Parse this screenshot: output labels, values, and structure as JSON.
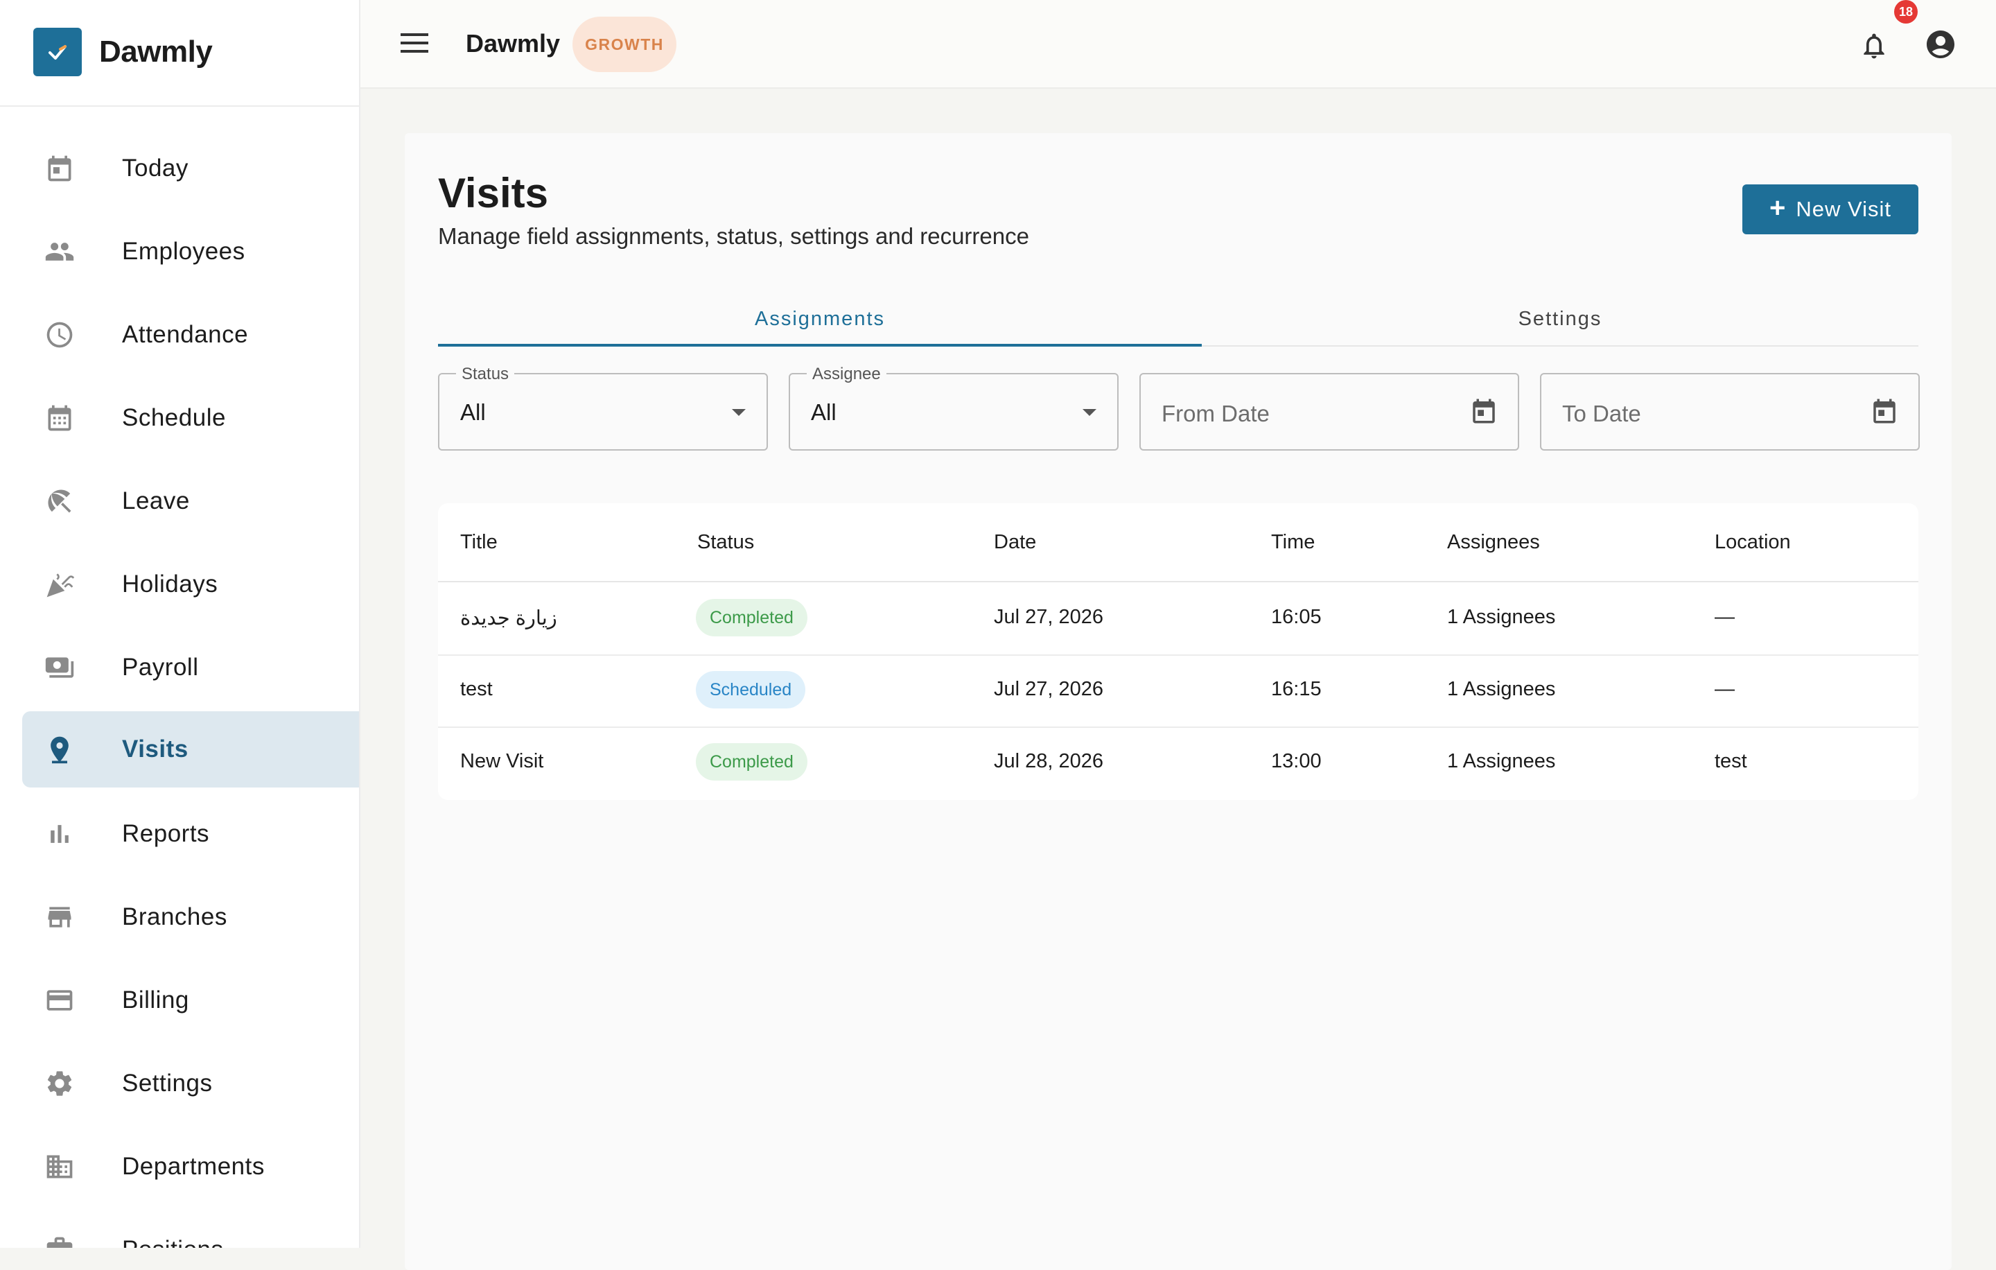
{
  "app": {
    "name": "Dawmly",
    "plan": "GROWTH",
    "notifications": "18"
  },
  "sidebar": {
    "items": [
      {
        "label": "Today",
        "icon": "calendar-today-icon"
      },
      {
        "label": "Employees",
        "icon": "people-icon"
      },
      {
        "label": "Attendance",
        "icon": "clock-icon"
      },
      {
        "label": "Schedule",
        "icon": "calendar-grid-icon"
      },
      {
        "label": "Leave",
        "icon": "beach-umbrella-icon"
      },
      {
        "label": "Holidays",
        "icon": "celebration-icon"
      },
      {
        "label": "Payroll",
        "icon": "money-icon"
      },
      {
        "label": "Visits",
        "icon": "location-pin-icon",
        "active": true
      },
      {
        "label": "Reports",
        "icon": "bar-chart-icon"
      },
      {
        "label": "Branches",
        "icon": "store-icon"
      },
      {
        "label": "Billing",
        "icon": "credit-card-icon"
      },
      {
        "label": "Settings",
        "icon": "gear-icon"
      },
      {
        "label": "Departments",
        "icon": "building-icon"
      },
      {
        "label": "Positions",
        "icon": "briefcase-icon"
      }
    ]
  },
  "page": {
    "title": "Visits",
    "subtitle": "Manage field assignments, status, settings and recurrence",
    "new_button": "New Visit"
  },
  "tabs": [
    {
      "label": "Assignments",
      "active": true
    },
    {
      "label": "Settings"
    }
  ],
  "filters": {
    "status": {
      "label": "Status",
      "value": "All"
    },
    "assignee": {
      "label": "Assignee",
      "value": "All"
    },
    "from_date": {
      "placeholder": "From Date"
    },
    "to_date": {
      "placeholder": "To Date"
    }
  },
  "table": {
    "headers": [
      "Title",
      "Status",
      "Date",
      "Time",
      "Assignees",
      "Location"
    ],
    "rows": [
      {
        "title": "زيارة جديدة",
        "status": "Completed",
        "date": "Jul 27, 2026",
        "time": "16:05",
        "assignees": "1 Assignees",
        "location": "—"
      },
      {
        "title": "test",
        "status": "Scheduled",
        "date": "Jul 27, 2026",
        "time": "16:15",
        "assignees": "1 Assignees",
        "location": "—"
      },
      {
        "title": "New Visit",
        "status": "Completed",
        "date": "Jul 28, 2026",
        "time": "13:00",
        "assignees": "1 Assignees",
        "location": "test"
      }
    ]
  },
  "colors": {
    "accent": "#1e6f98",
    "completed": "#3c9a49",
    "scheduled": "#2985c6",
    "plan_badge": "#d9834b",
    "notification": "#e53935"
  }
}
